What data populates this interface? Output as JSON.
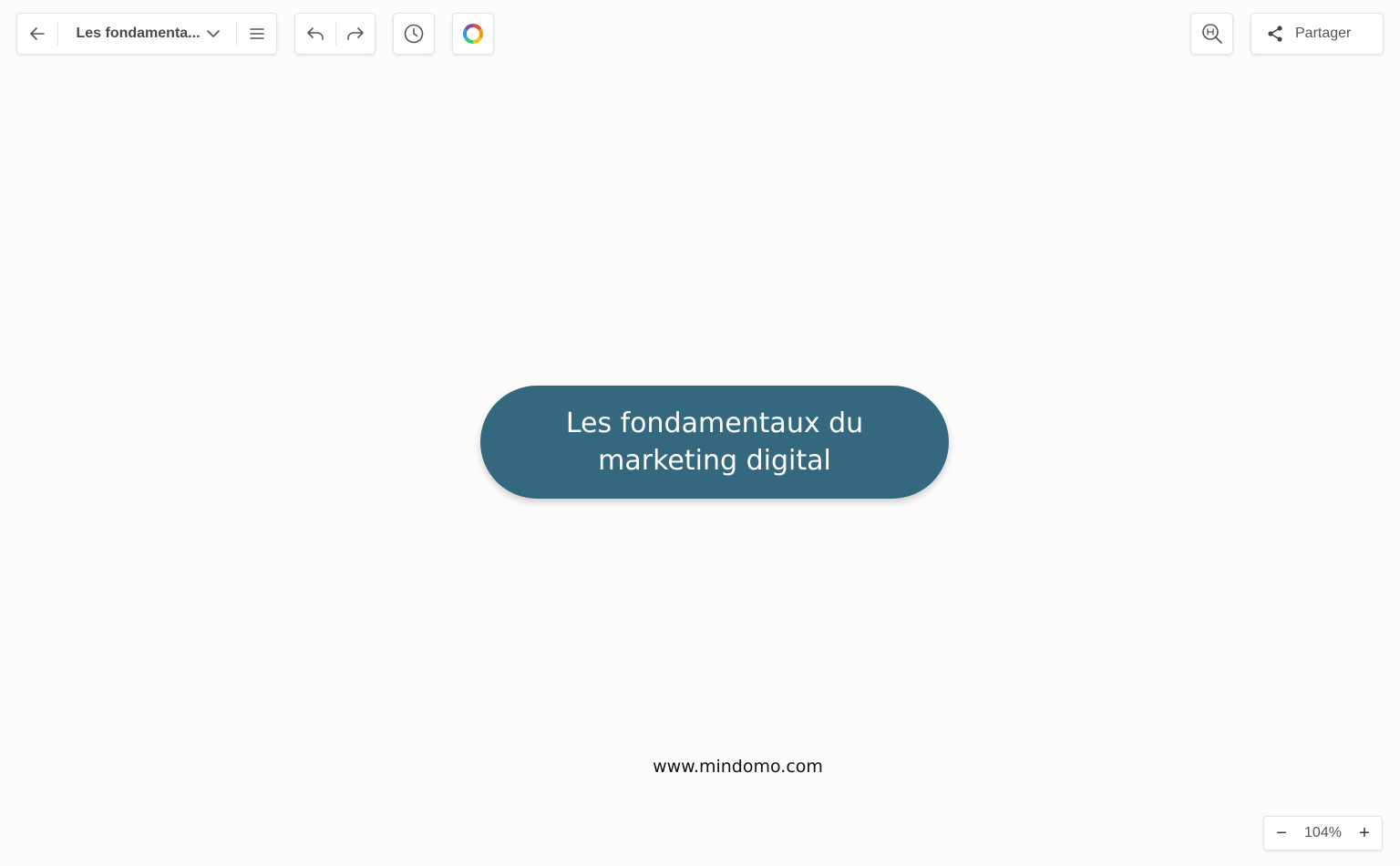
{
  "header": {
    "map_title": "Les fondamenta...",
    "share_label": "Partager"
  },
  "icons": {
    "back": "arrow-left-icon",
    "title_dropdown": "chevron-down-icon",
    "menu": "hamburger-menu-icon",
    "undo": "undo-icon",
    "redo": "redo-icon",
    "history": "clock-icon",
    "theme": "color-wheel-icon",
    "search": "search-zoom-icon",
    "share": "share-icon"
  },
  "canvas": {
    "central_topic": "Les fondamentaux du\nmarketing digital",
    "watermark": "www.mindomo.com"
  },
  "zoom": {
    "minus": "−",
    "level": "104%",
    "plus": "+"
  },
  "colors": {
    "central_topic_bg": "#34687f",
    "canvas_bg": "#fcfcfc"
  }
}
